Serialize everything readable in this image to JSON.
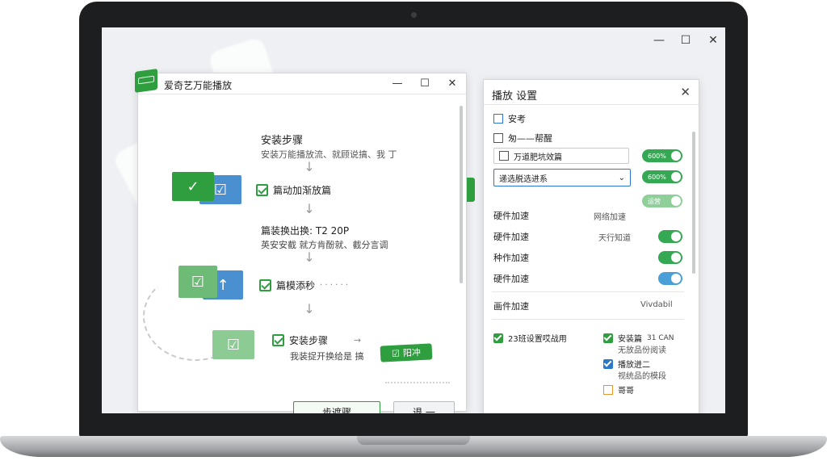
{
  "desktop": {
    "minimize": "—",
    "maximize": "☐",
    "close": "✕"
  },
  "main_window": {
    "title": "爱奇艺万能播放",
    "controls": {
      "minimize": "—",
      "maximize": "☐",
      "close": "✕"
    },
    "steps_title": "安装步骤",
    "steps_subtitle": "安装万能播放流、就顾说搞、我 丁",
    "step1": {
      "label": "篇动加渐放篇"
    },
    "step2": {
      "title": "篇装换出换: T2 20P",
      "subtitle": "英安安截 就方肯酚就、截分言调"
    },
    "step3": {
      "label": "篇模添秒"
    },
    "step4": {
      "label": "安装步骤",
      "subtitle": "我装捉开换给是 搞"
    },
    "ok_pill": "阳冲",
    "buttons": {
      "next": "步遮骤",
      "back": "退 一"
    }
  },
  "settings": {
    "title": "播放 设置",
    "close": "✕",
    "opt_anzhuang": "安考",
    "opt_second": "匆——帮醒",
    "textbox_value": "万道肥坑效篇",
    "select_value": "递选脱选进系",
    "toggle1_text": "600%",
    "toggle2_text": "600%",
    "toggle3_text": "运营",
    "hw1": {
      "label": "硬件加速",
      "value": "网络加速"
    },
    "hw2": {
      "label": "硬件加速",
      "value": "天行知道"
    },
    "hw3": {
      "label": "种作加速"
    },
    "hw4": {
      "label": "硬件加速"
    },
    "hw5": {
      "label": "画件加速",
      "value": "Vivdabil"
    },
    "opt_default": "23班设置哎战用",
    "opt_right1": {
      "label": "安装篇",
      "extra": "31 CAN",
      "sub": "无放品份阅读"
    },
    "opt_right2": {
      "label": "播放迸二",
      "sub": "视统品的模段"
    },
    "opt_right3": {
      "label": "哥哥"
    }
  },
  "colors": {
    "accent_green": "#2e9e3f",
    "accent_blue": "#2b78c8",
    "toggle_green": "#34a853"
  }
}
